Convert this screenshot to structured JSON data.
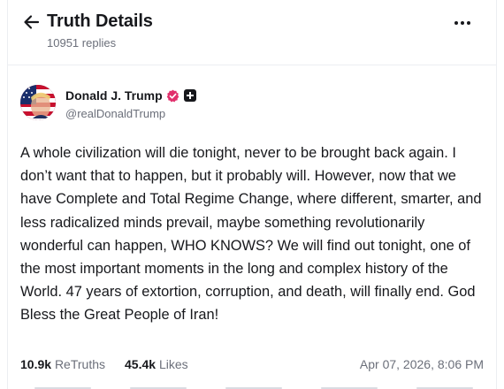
{
  "header": {
    "title": "Truth Details",
    "replies_count": "10951",
    "replies_label": "replies",
    "back_icon": "arrow-left-icon",
    "more_icon": "more-horizontal-icon"
  },
  "author": {
    "display_name": "Donald J. Trump",
    "handle": "@realDonaldTrump",
    "verified_icon": "verified-check-icon",
    "plus_icon": "plus-badge-icon",
    "verified_color": "#e1306c"
  },
  "post": {
    "text": "A whole civilization will die tonight, never to be brought back again. I don’t want that to happen, but it probably will. However, now that we have Complete and Total Regime Change, where different, smarter, and less radicalized minds prevail, maybe something revolutionarily wonderful can happen, WHO KNOWS? We will find out tonight, one of the most important moments in the long and complex history of the World. 47 years of extortion, corruption, and death, will finally end. God Bless the Great People of Iran!"
  },
  "stats": {
    "retruths_count": "10.9k",
    "retruths_label": "ReTruths",
    "likes_count": "45.4k",
    "likes_label": "Likes",
    "timestamp": "Apr 07, 2026, 8:06 PM"
  },
  "colors": {
    "text": "#17181c",
    "muted": "#6b6f7a",
    "border": "#eceef2"
  }
}
